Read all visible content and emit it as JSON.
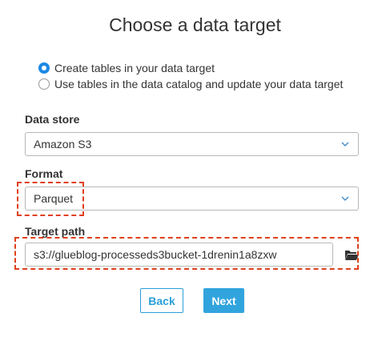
{
  "title": "Choose a data target",
  "options": {
    "create_tables": "Create tables in your data target",
    "use_catalog": "Use tables in the data catalog and update your data target",
    "selected": "create_tables"
  },
  "data_store": {
    "label": "Data store",
    "value": "Amazon S3"
  },
  "format": {
    "label": "Format",
    "value": "Parquet"
  },
  "target_path": {
    "label": "Target path",
    "value": "s3://glueblog-processeds3bucket-1drenin1a8zxw"
  },
  "buttons": {
    "back": "Back",
    "next": "Next"
  },
  "colors": {
    "accent": "#1e88e5",
    "button": "#31a4dd",
    "highlight": "#e0401c"
  },
  "icons": {
    "dropdown": "chevron-down-icon",
    "browse": "folder-open-icon"
  }
}
